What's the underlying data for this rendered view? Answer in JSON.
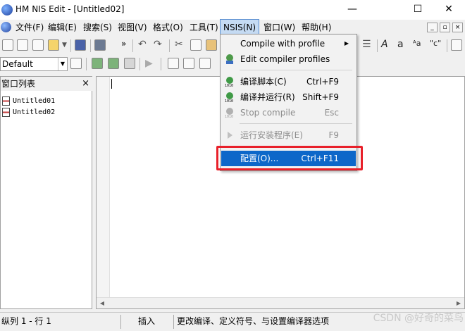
{
  "window": {
    "title": "HM NIS Edit - [Untitled02]",
    "minimize_glyph": "—",
    "maximize_glyph": "☐",
    "close_glyph": "✕"
  },
  "menubar": {
    "items": [
      "文件(F)",
      "编辑(E)",
      "搜索(S)",
      "视图(V)",
      "格式(O)",
      "工具(T)",
      "NSIS(N)",
      "窗口(W)",
      "帮助(H)"
    ],
    "active": "NSIS(N)",
    "mdi_buttons": [
      "_",
      "▫",
      "×"
    ]
  },
  "toolbar2": {
    "style_value": "Default"
  },
  "document_panel": {
    "title": "窗口列表",
    "close_glyph": "×",
    "documents": [
      "Untitled01",
      "Untitled02"
    ]
  },
  "nsis_menu": {
    "items": [
      {
        "label": "Compile with profile",
        "shortcut": "",
        "submenu": true,
        "disabled": false,
        "icon": "none"
      },
      {
        "label": "Edit compiler profiles",
        "shortcut": "",
        "submenu": false,
        "disabled": false,
        "icon": "profile-icon"
      },
      {
        "label": "编译脚本(C)",
        "shortcut": "Ctrl+F9",
        "submenu": false,
        "disabled": false,
        "icon": "compile-icon"
      },
      {
        "label": "编译并运行(R)",
        "shortcut": "Shift+F9",
        "submenu": false,
        "disabled": false,
        "icon": "compile-run-icon"
      },
      {
        "label": "Stop compile",
        "shortcut": "Esc",
        "submenu": false,
        "disabled": true,
        "icon": "stop-compile-icon"
      },
      {
        "label": "运行安装程序(E)",
        "shortcut": "F9",
        "submenu": false,
        "disabled": true,
        "icon": "run-arrow-icon"
      },
      {
        "label": "配置(O)...",
        "shortcut": "Ctrl+F11",
        "submenu": false,
        "disabled": false,
        "icon": "none",
        "highlighted": true
      }
    ],
    "highlight_color": "#0d67c9",
    "callout_color": "#e8202a"
  },
  "statusbar": {
    "position": "纵列 1 - 行 1",
    "mode": "插入",
    "hint": "更改编译、定义符号、与设置编译器选项"
  },
  "watermark": "CSDN @好奇的菜鸟"
}
